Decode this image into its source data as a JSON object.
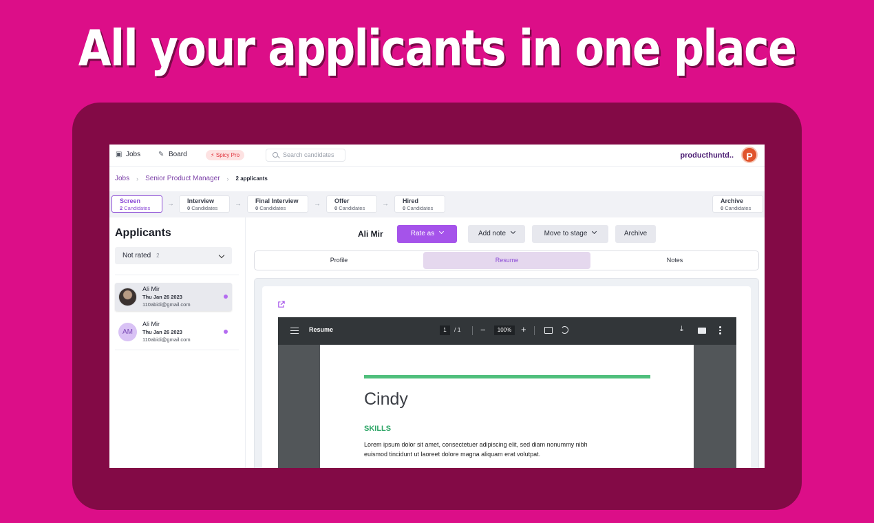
{
  "headline": "All your applicants in one place",
  "nav": {
    "jobs": "Jobs",
    "board": "Board",
    "pro_badge": "Spicy Pro",
    "search_placeholder": "Search candidates",
    "org_name": "producthuntd..",
    "org_avatar": "P"
  },
  "breadcrumb": {
    "jobs": "Jobs",
    "job": "Senior Product Manager",
    "current": "2 applicants"
  },
  "stages": [
    {
      "name": "Screen",
      "count": "2",
      "suffix": "Candidates"
    },
    {
      "name": "Interview",
      "count": "0",
      "suffix": "Candidates"
    },
    {
      "name": "Final Interview",
      "count": "0",
      "suffix": "Candidates"
    },
    {
      "name": "Offer",
      "count": "0",
      "suffix": "Candidates"
    },
    {
      "name": "Hired",
      "count": "0",
      "suffix": "Candidates"
    },
    {
      "name": "Archive",
      "count": "0",
      "suffix": "Candidates"
    }
  ],
  "applicants": {
    "title": "Applicants",
    "filter_label": "Not rated",
    "filter_count": "2",
    "list": [
      {
        "name": "Ali Mir",
        "date": "Thu Jan 26 2023",
        "email": "110abidi@gmail.com",
        "initials": ""
      },
      {
        "name": "Ali Mir",
        "date": "Thu Jan 26 2023",
        "email": "110abidi@gmail.com",
        "initials": "AM"
      }
    ]
  },
  "detail": {
    "candidate_name": "Ali Mir",
    "rate_label": "Rate as",
    "note_label": "Add note",
    "move_label": "Move to stage",
    "archive_label": "Archive",
    "tabs": [
      "Profile",
      "Resume",
      "Notes"
    ],
    "active_tab": "Resume"
  },
  "pdf": {
    "title": "Resume",
    "page": "1",
    "page_total": "/ 1",
    "zoom": "100%",
    "doc_name": "Cindy",
    "section": "SKILLS",
    "body": "Lorem ipsum dolor sit amet, consectetuer adipiscing elit, sed diam nonummy nibh euismod tincidunt ut laoreet dolore magna aliquam erat volutpat."
  },
  "colors": {
    "background": "#dc0e88",
    "frame": "#830a46",
    "accent": "#a553ea",
    "resume_accent": "#4fbf7c"
  }
}
